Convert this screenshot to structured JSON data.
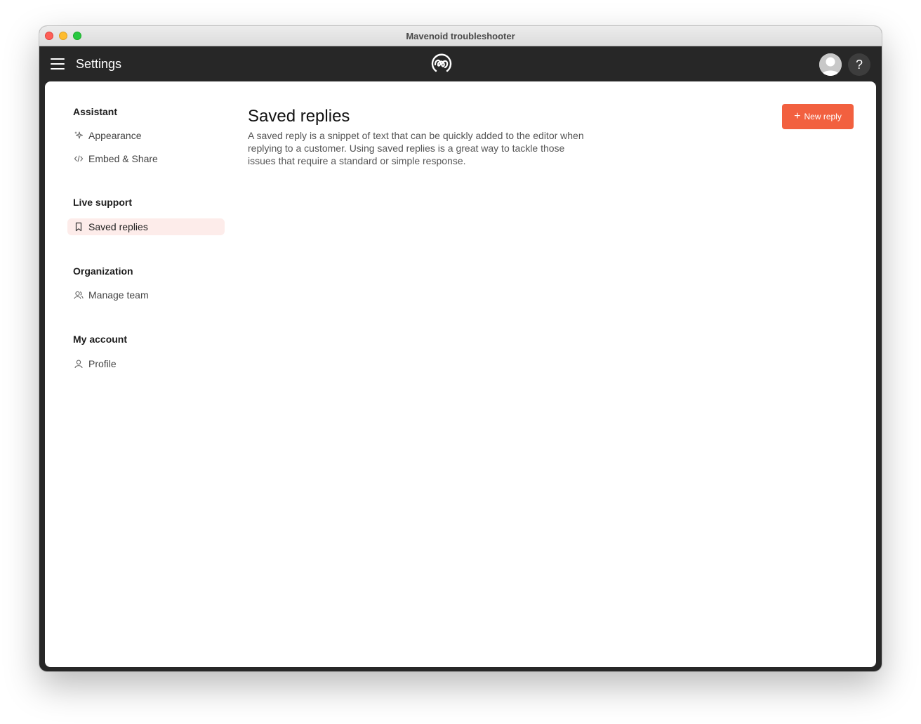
{
  "window": {
    "title": "Mavenoid troubleshooter"
  },
  "appbar": {
    "title": "Settings",
    "help_label": "?"
  },
  "sidebar": {
    "groups": [
      {
        "heading": "Assistant",
        "items": [
          {
            "label": "Appearance",
            "icon": "sparkle-icon"
          },
          {
            "label": "Embed & Share",
            "icon": "code-icon"
          }
        ]
      },
      {
        "heading": "Live support",
        "items": [
          {
            "label": "Saved replies",
            "icon": "bookmark-icon",
            "active": true
          }
        ]
      },
      {
        "heading": "Organization",
        "items": [
          {
            "label": "Manage team",
            "icon": "team-icon"
          }
        ]
      },
      {
        "heading": "My account",
        "items": [
          {
            "label": "Profile",
            "icon": "user-icon"
          }
        ]
      }
    ]
  },
  "main": {
    "title": "Saved replies",
    "description": "A saved reply is a snippet of text that can be quickly added to the editor when replying to a customer. Using saved replies is a great way to tackle those issues that require a standard or simple response.",
    "new_button_label": "New reply"
  },
  "colors": {
    "accent": "#f2603f",
    "active_bg": "#fdecea",
    "appbar": "#272727"
  }
}
